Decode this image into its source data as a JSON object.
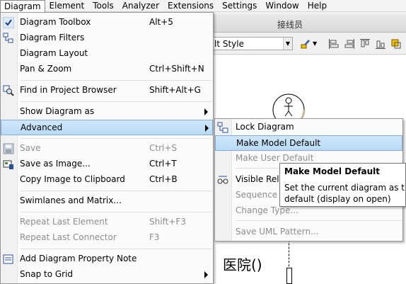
{
  "menubar": {
    "items": [
      "Diagram",
      "Element",
      "Tools",
      "Analyzer",
      "Extensions",
      "Settings",
      "Window",
      "Help"
    ]
  },
  "background": {
    "tab_title": "接线员",
    "style_combo_value": "lt Style",
    "canvas_text": "医院()"
  },
  "diagram_menu": {
    "items": [
      {
        "label": "Diagram Toolbox",
        "shortcut": "Alt+5",
        "icon": "checkmark-icon",
        "enabled": true
      },
      {
        "label": "Diagram Filters",
        "shortcut": "",
        "icon": "diagram-filters-icon",
        "enabled": true
      },
      {
        "label": "Diagram Layout",
        "shortcut": "",
        "enabled": true
      },
      {
        "label": "Pan & Zoom",
        "shortcut": "Ctrl+Shift+N",
        "enabled": true
      },
      {
        "label": "Find in Project Browser",
        "shortcut": "Shift+Alt+G",
        "icon": "find-in-browser-icon",
        "enabled": true
      },
      {
        "label": "Show Diagram as",
        "shortcut": "",
        "submenu": true,
        "enabled": true
      },
      {
        "label": "Advanced",
        "shortcut": "",
        "submenu": true,
        "enabled": true,
        "highlighted": true
      },
      {
        "label": "Save",
        "shortcut": "Ctrl+S",
        "icon": "save-icon",
        "enabled": false
      },
      {
        "label": "Save as Image...",
        "shortcut": "Ctrl+T",
        "icon": "save-image-icon",
        "enabled": true
      },
      {
        "label": "Copy Image to Clipboard",
        "shortcut": "Ctrl+B",
        "enabled": true
      },
      {
        "label": "Swimlanes and Matrix...",
        "shortcut": "",
        "enabled": true
      },
      {
        "label": "Repeat Last Element",
        "shortcut": "Shift+F3",
        "enabled": false
      },
      {
        "label": "Repeat Last Connector",
        "shortcut": "F3",
        "enabled": false
      },
      {
        "label": "Add Diagram Property Note",
        "shortcut": "",
        "icon": "property-note-icon",
        "enabled": true
      },
      {
        "label": "Snap to Grid",
        "shortcut": "",
        "submenu": true,
        "enabled": true
      }
    ]
  },
  "advanced_submenu": {
    "items": [
      {
        "label": "Lock Diagram",
        "icon": "lock-diagram-icon",
        "enabled": true
      },
      {
        "label": "Make Model Default",
        "enabled": true,
        "highlighted": true
      },
      {
        "label": "Make User Default",
        "enabled": false
      },
      {
        "label": "Visible Rela",
        "icon": "visible-relations-icon",
        "enabled": true
      },
      {
        "label": "Sequence M",
        "enabled": false
      },
      {
        "label": "Change Type...",
        "enabled": false
      },
      {
        "label": "Save UML Pattern...",
        "enabled": false
      }
    ]
  },
  "tooltip": {
    "title": "Make Model Default",
    "line1": "Set the current diagram as the mo",
    "line2": "default (display on open)"
  },
  "colors": {
    "highlight": "#b9dbf6",
    "highlight_border": "#84acdd",
    "disabled_text": "#8d8d8d"
  }
}
